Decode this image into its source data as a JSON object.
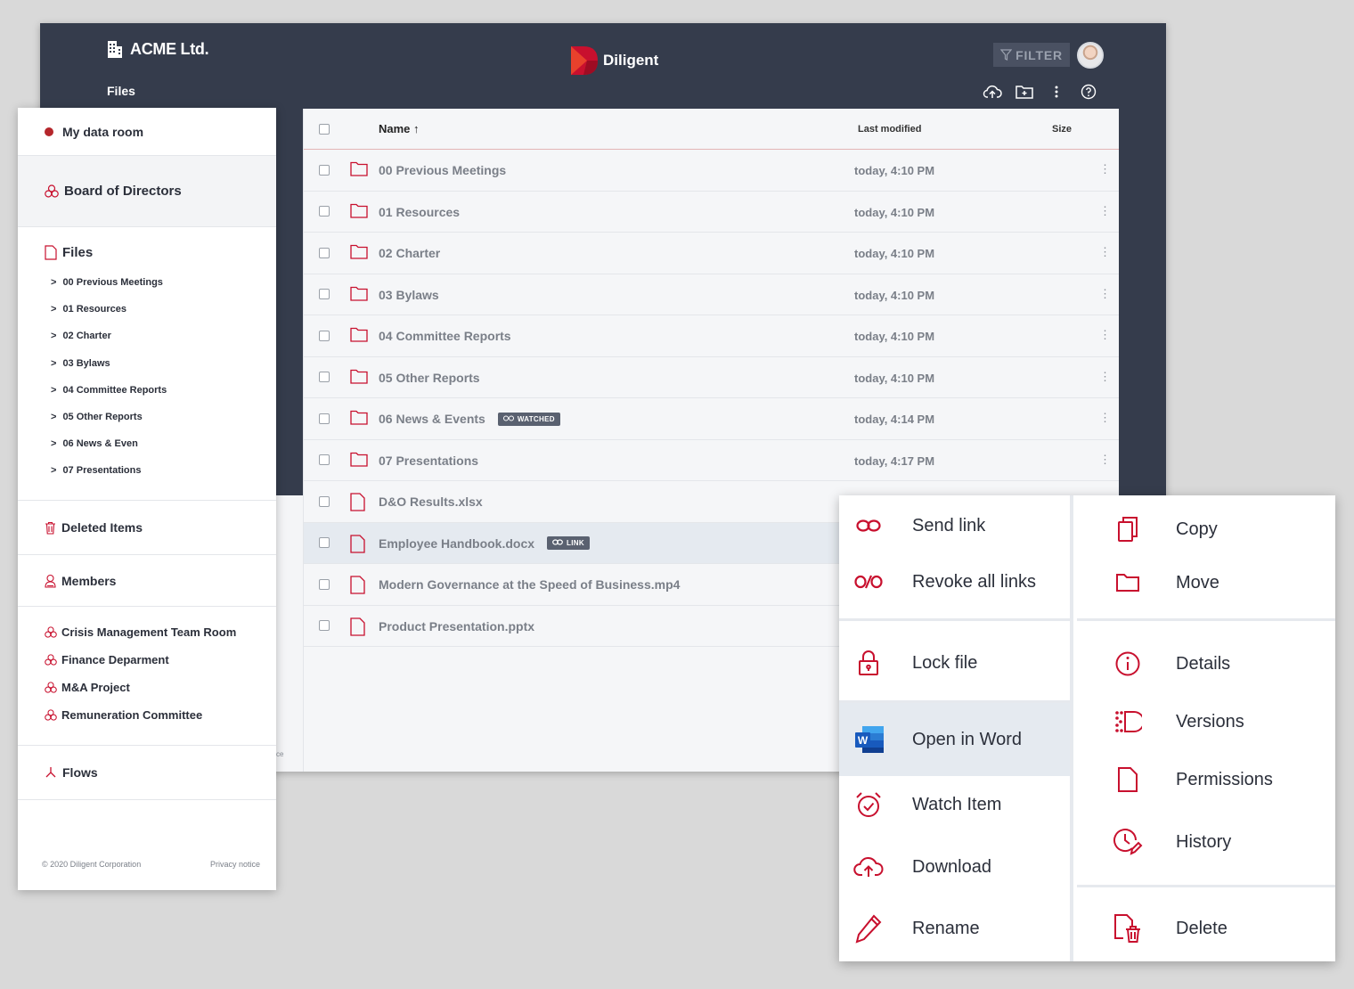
{
  "header": {
    "company": "ACME Ltd.",
    "section": "Files",
    "logo_text": "Diligent",
    "filter_label": "FILTER",
    "accent": "#c8102e",
    "bg": "#353c4c"
  },
  "table": {
    "col_name": "Name",
    "col_sort": "↑",
    "col_modified": "Last modified",
    "col_size": "Size",
    "rows": [
      {
        "name": "00 Previous Meetings",
        "date": "today, 4:10 PM",
        "kind": "folder"
      },
      {
        "name": "01 Resources",
        "date": "today, 4:10 PM",
        "kind": "folder"
      },
      {
        "name": "02 Charter",
        "date": "today, 4:10 PM",
        "kind": "folder"
      },
      {
        "name": "03 Bylaws",
        "date": "today, 4:10 PM",
        "kind": "folder"
      },
      {
        "name": "04 Committee Reports",
        "date": "today, 4:10 PM",
        "kind": "folder"
      },
      {
        "name": "05 Other Reports",
        "date": "today, 4:10 PM",
        "kind": "folder"
      },
      {
        "name": "06 News & Events",
        "date": "today, 4:14 PM",
        "kind": "folder",
        "badge": "WATCHED"
      },
      {
        "name": "07 Presentations",
        "date": "today, 4:17 PM",
        "kind": "folder"
      },
      {
        "name": "D&O Results.xlsx",
        "date": "",
        "kind": "file"
      },
      {
        "name": "Employee Handbook.docx",
        "date": "",
        "kind": "file",
        "badge": "LINK"
      },
      {
        "name": "Modern Governance at the Speed of Business.mp4",
        "date": "",
        "kind": "file"
      },
      {
        "name": "Product Presentation.pptx",
        "date": "",
        "kind": "file"
      }
    ],
    "behind_notice": "tice"
  },
  "sidebar": {
    "my_data_room": "My data room",
    "board": "Board of Directors",
    "files": "Files",
    "folders": [
      "00 Previous Meetings",
      "01 Resources",
      "02 Charter",
      "03 Bylaws",
      "04 Committee Reports",
      "05 Other Reports",
      "06 News & Even",
      "07 Presentations"
    ],
    "chevron": ">",
    "deleted": "Deleted Items",
    "members": "Members",
    "rooms": [
      "Crisis Management Team Room",
      "Finance Deparment",
      "M&A Project",
      "Remuneration Committee"
    ],
    "flows": "Flows",
    "copyright": "© 2020 Diligent Corporation",
    "privacy": "Privacy notice"
  },
  "menu": {
    "send_link": "Send link",
    "revoke_links": "Revoke all links",
    "lock_file": "Lock file",
    "open_in_word": "Open in Word",
    "word_badge": "W",
    "watch_item": "Watch Item",
    "download": "Download",
    "rename": "Rename",
    "copy": "Copy",
    "move": "Move",
    "details": "Details",
    "versions": "Versions",
    "permissions": "Permissions",
    "history": "History",
    "delete": "Delete"
  }
}
